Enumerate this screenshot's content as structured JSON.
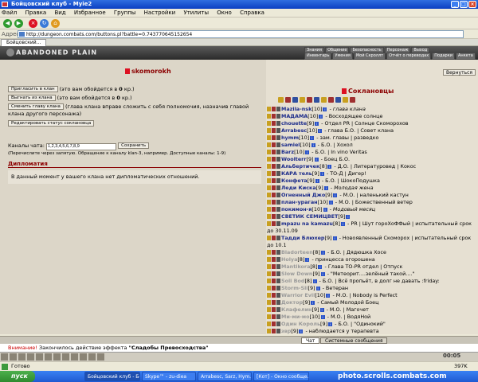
{
  "window": {
    "title": "Бойцовский клуб - Myie2"
  },
  "menu": [
    "Файл",
    "Правка",
    "Вид",
    "Избранное",
    "Группы",
    "Настройки",
    "Утилиты",
    "Окно",
    "Справка"
  ],
  "address": {
    "label": "Адрес",
    "url": "http://dungeon.combats.com/buttons.pl?battle=0.743770645152654"
  },
  "tabs": [
    "Бойцовский..."
  ],
  "game": {
    "logo": "ABANDONED PLAIN",
    "nav_top": [
      "Знания",
      "Общение",
      "Безопасность",
      "Персонаж",
      "Выход"
    ],
    "nav_bottom": [
      "Инвентарь",
      "Умения",
      "Мой Скроллт",
      "Отчёт о переводах",
      "Подарки",
      "Анкета"
    ]
  },
  "clan": {
    "name": "skomorokh",
    "invite": {
      "btn": "Пригласить в клан",
      "text": "(это вам обойдется в",
      "cost": "0",
      "unit": "кр.)"
    },
    "kick": {
      "btn": "Выгнать из клана",
      "text": "(это вам обойдется в",
      "cost": "0",
      "unit": "кр.)"
    },
    "transfer": {
      "btn": "Сменить главу клана",
      "text": "(глава клана вправе сложить с себя полномочия, назначив главой клана другого персонажа)"
    },
    "edit_status_btn": "Редактировать статус соклановца",
    "channels_label": "Каналы чата:",
    "channels_value": "1,2,3,4,5,6,7,8,9",
    "save_btn": "Сохранить",
    "channels_hint": "(Перечислите через запятую. Обращение к каналу klan-3, например. Доступные каналы: 1-9)",
    "diplomacy_title": "Дипломатия",
    "diplomacy_text": "В данный момент у вашего клана нет дипломатических отношений."
  },
  "sidebar": {
    "return_btn": "Вернуться",
    "members_title": "Соклановцы",
    "members": [
      {
        "name": "Mazila-nsk",
        "lvl": "[10]",
        "desc": "- глава клана",
        "online": true,
        "italic": true
      },
      {
        "name": "МАДАМА",
        "lvl": "[10]",
        "desc": "- Восходящее солнце",
        "online": true,
        "italic": false
      },
      {
        "name": "chouette",
        "lvl": "[9]",
        "desc": "- Отдел PR | Солнце Скоморохов",
        "online": true,
        "italic": false
      },
      {
        "name": "Arrabesc",
        "lvl": "[10]",
        "desc": "- глава Б.О. | Совет клана",
        "online": true,
        "italic": false
      },
      {
        "name": "hymm",
        "lvl": "[10]",
        "desc": "- зам. главы | разведко",
        "online": true,
        "italic": false
      },
      {
        "name": "samiel",
        "lvl": "[10]",
        "desc": "- Б.О. | Хохол",
        "online": true,
        "italic": false
      },
      {
        "name": "Barz",
        "lvl": "[10]",
        "desc": "- Б.О. | In vino Veritas",
        "online": true,
        "italic": false
      },
      {
        "name": "Woolterr",
        "lvl": "[9]",
        "desc": "- Боец Б.О.",
        "online": true,
        "italic": false
      },
      {
        "name": "Альбертичек",
        "lvl": "[8]",
        "desc": "- Д.О. | Литературовед | Кокос",
        "online": true,
        "italic": false
      },
      {
        "name": "КАРА тель",
        "lvl": "[9]",
        "desc": "- ТО-Д | Дигер!",
        "online": true,
        "italic": false
      },
      {
        "name": "Конфета",
        "lvl": "[9]",
        "desc": "- Б.О. | ШокоПодушка",
        "online": true,
        "italic": false
      },
      {
        "name": "Леди Киска",
        "lvl": "[9]",
        "desc": "- Молодая жена",
        "online": true,
        "italic": true
      },
      {
        "name": "Огненный Джо",
        "lvl": "[9]",
        "desc": "- М.О. | наленький кастун",
        "online": true,
        "italic": false
      },
      {
        "name": "план-ураган",
        "lvl": "[10]",
        "desc": "- М.О. | Божественный ветер",
        "online": true,
        "italic": false
      },
      {
        "name": "покимон-я",
        "lvl": "[10]",
        "desc": "- Модовый месяц",
        "online": true,
        "italic": true
      },
      {
        "name": "СВЕТИК СЕМИЦВЕТ",
        "lvl": "[9]",
        "desc": "",
        "online": true,
        "italic": false
      },
      {
        "name": "mpazu na kamazu",
        "lvl": "[8]",
        "desc": "- PR | Шут гороХоФФый | испытательный срок до 30.11.09",
        "online": true,
        "italic": false
      },
      {
        "name": "Тадди Блюхер",
        "lvl": "[9]",
        "desc": "- Новоявленный Скоморох | испытательный срок до 10.1",
        "online": true,
        "italic": false
      },
      {
        "name": "Bladorteen",
        "lvl": "[8]",
        "desc": "- Б.О. | Дядюшка Хосе",
        "online": false,
        "italic": false
      },
      {
        "name": "Holya",
        "lvl": "[8]",
        "desc": "- принцесса огорошена",
        "online": false,
        "italic": false
      },
      {
        "name": "Mantikora",
        "lvl": "[8]",
        "desc": "- Глава ТО-PR отдел | Отпуск",
        "online": false,
        "italic": false
      },
      {
        "name": "Slow Down",
        "lvl": "[9]",
        "desc": "- \"Метеорит....зелёный такой....\"",
        "online": false,
        "italic": false
      },
      {
        "name": "Soll Bod",
        "lvl": "[8]",
        "desc": "- Б.О. | Всё пропьёт, в долг не давать :friday:",
        "online": false,
        "italic": false
      },
      {
        "name": "Storm-Sli",
        "lvl": "[9]",
        "desc": "- Ветеран",
        "online": false,
        "italic": false
      },
      {
        "name": "Warrior Evil",
        "lvl": "[10]",
        "desc": "- М.О. | Nobody is Perfect",
        "online": false,
        "italic": false
      },
      {
        "name": "Доктор",
        "lvl": "[9]",
        "desc": "- Самый Молодой Боец",
        "online": false,
        "italic": false
      },
      {
        "name": "Клафелин",
        "lvl": "[9]",
        "desc": "- М.О. | Магочет",
        "online": false,
        "italic": false
      },
      {
        "name": "Ми-ми-мо",
        "lvl": "[10]",
        "desc": "- М.О. | ВодяНой",
        "online": false,
        "italic": false
      },
      {
        "name": "Один Король",
        "lvl": "[9]",
        "desc": "- Б.О. | \"Одинокий\"",
        "online": false,
        "italic": false
      },
      {
        "name": "звр",
        "lvl": "[9]",
        "desc": "- наблюдается у терапевта",
        "online": false,
        "italic": false
      },
      {
        "name": "Gegira",
        "lvl": "[9]",
        "desc": "- М.О. | УраганЕГ",
        "online": false,
        "italic": false
      },
      {
        "name": "GOD OF HAMMER",
        "lvl": "[9]",
        "desc": "- Б.О. | Steel rat",
        "online": false,
        "italic": false
      }
    ]
  },
  "chat": {
    "tabs": [
      "Чат",
      "Системные сообщения"
    ],
    "sys_prefix": "Внимание!",
    "line": "Закончилось действие эффекта",
    "effect": "\"Сладобы Превосходства\""
  },
  "gametool": {
    "clock": "00:05"
  },
  "status": {
    "left": "Готово",
    "right": "397K"
  },
  "taskbar": {
    "start": "пуск",
    "items": [
      "Бойцовский клуб - Бойц...",
      "Skype™ - zu-diea",
      "Arrabesc, Sarz, Hym...",
      "[Кот] - Окно сообще..."
    ],
    "watermark": "photo.scrolls.combats.com"
  },
  "colors": {
    "accent": "#8b0000",
    "online": "#1a2a8a",
    "offline": "#9a9a9a"
  }
}
